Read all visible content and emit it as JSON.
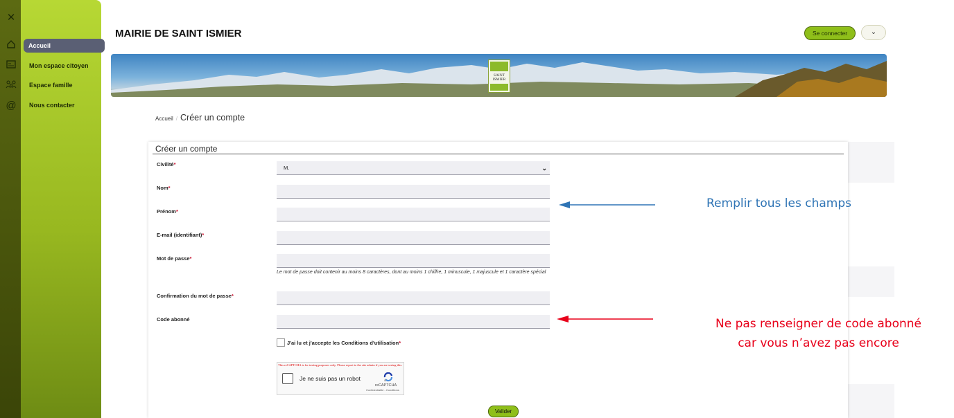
{
  "window": {
    "close_glyph": "✕"
  },
  "sidebar": {
    "items": [
      {
        "label": "Accueil",
        "icon": "home-icon",
        "active": true
      },
      {
        "label": "Mon espace citoyen",
        "icon": "id-card-icon"
      },
      {
        "label": "Espace famille",
        "icon": "family-icon"
      },
      {
        "label": "Nous contacter",
        "icon": "at-icon"
      }
    ]
  },
  "header": {
    "title": "MAIRIE DE SAINT ISMIER",
    "login_label": "Se connecter",
    "menu_icon": "chevron-down-icon"
  },
  "banner": {
    "logo_text": "SAINT ISMIER"
  },
  "breadcrumb": {
    "home": "Accueil",
    "separator": "/",
    "current": "Créer un compte"
  },
  "form": {
    "title": "Créer un compte",
    "required_mark": "*",
    "fields": [
      {
        "label": "Civilité",
        "value": "M.",
        "required": true
      },
      {
        "label": "Nom",
        "required": true
      },
      {
        "label": "Prénom",
        "required": true
      },
      {
        "label": "E-mail (identifiant)",
        "required": true
      },
      {
        "label": "Mot de passe",
        "required": true
      },
      {
        "label": "Confirmation du mot de passe",
        "required": true
      },
      {
        "label": "Code abonné",
        "required": false
      }
    ],
    "password_help": "Le mot de passe doit contenir au moins 8 caractères, dont au moins 1 chiffre, 1 minuscule, 1 majuscule et 1 caractère spécial",
    "terms_label": "J'ai lu et j'accepte les Conditions d'utilisation",
    "captcha": {
      "warning": "This reCAPTCHA is for testing purposes only. Please report to the site admin if you are seeing this.",
      "label": "Je ne suis pas un robot",
      "brand": "reCAPTCHA",
      "links": "Confidentialité - Conditions"
    },
    "submit_label": "Valider"
  },
  "annotations": {
    "fill_all": "Remplir tous les champs",
    "no_code_line1": "Ne pas renseigner de code abonné",
    "no_code_line2": "car vous n’avez pas encore",
    "colors": {
      "blue": "#2f74b5",
      "red": "#e8001a"
    }
  },
  "colors": {
    "sidebar_green": "#a8c92a",
    "button_green": "#8fbf1a",
    "active_item": "#5a5f74"
  }
}
